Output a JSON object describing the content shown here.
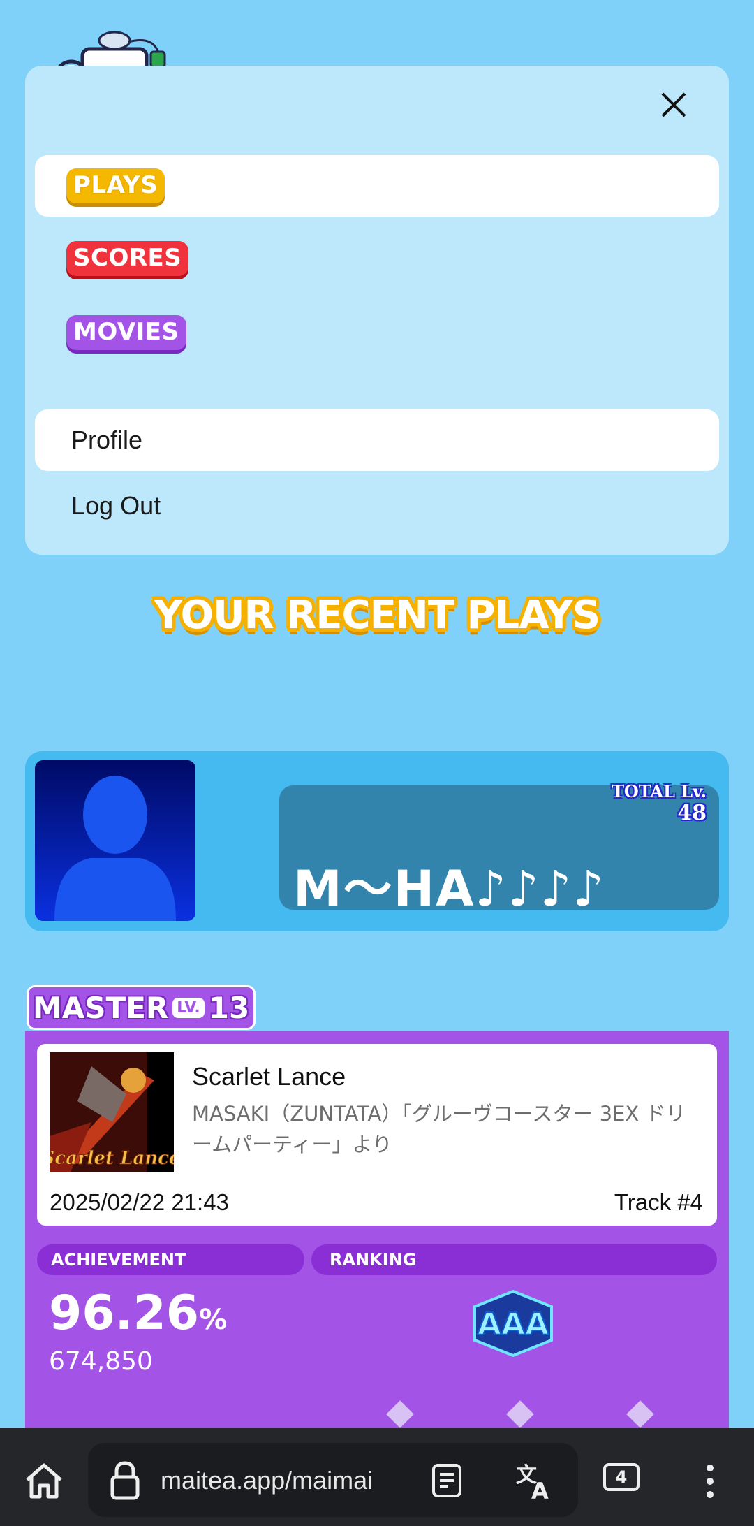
{
  "menu": {
    "items": [
      {
        "label": "PLAYS",
        "active": true
      },
      {
        "label": "SCORES",
        "active": false
      },
      {
        "label": "MOVIES",
        "active": false
      }
    ],
    "profile_label": "Profile",
    "logout_label": "Log Out"
  },
  "heading": "YOUR RECENT PLAYS",
  "player": {
    "total_lv_label": "TOTAL Lv.",
    "total_lv": "48",
    "name": "M〜HA♪♪♪♪"
  },
  "play": {
    "difficulty": "MASTER",
    "lv_tag": "LV.",
    "level": "13",
    "title": "Scarlet Lance",
    "artist": "MASAKI（ZUNTATA）「グルーヴコースター 3EX ドリームパーティー」より",
    "date": "2025/02/22 21:43",
    "track": "Track #4",
    "achievement_label": "ACHIEVEMENT",
    "ranking_label": "RANKING",
    "achievement_value": "96.26",
    "achievement_unit": "%",
    "score": "674,850",
    "rank": "AAA",
    "jacket_text": "Scarlet Lance"
  },
  "browser": {
    "url": "maitea.app/maimai",
    "tab_count": "4"
  },
  "colors": {
    "background": "#7fd1fa",
    "menu_panel": "#bde8fc",
    "plays": "#f5b800",
    "scores": "#f0323c",
    "movies": "#a353e6",
    "master": "#a353e6"
  }
}
